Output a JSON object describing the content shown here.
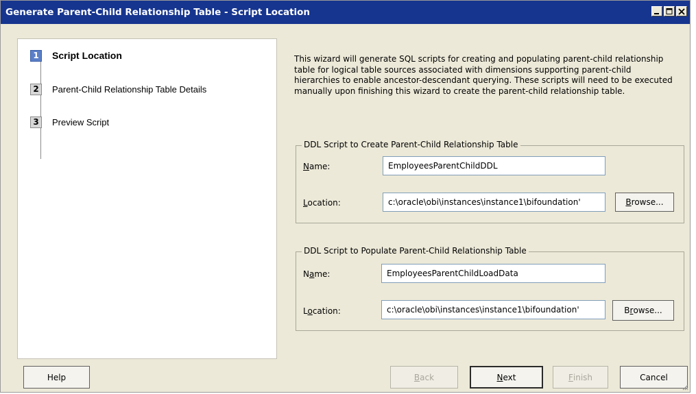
{
  "window": {
    "title": "Generate Parent-Child Relationship Table - Script Location",
    "controls": [
      "minimize-icon",
      "maximize-icon",
      "close-icon"
    ]
  },
  "steps": [
    {
      "number": "1",
      "label": "Script Location",
      "active": true
    },
    {
      "number": "2",
      "label": "Parent-Child Relationship Table Details",
      "active": false
    },
    {
      "number": "3",
      "label": "Preview Script",
      "active": false
    }
  ],
  "intro": "This wizard will generate SQL scripts for creating and populating parent-child relationship table for logical table sources associated with dimensions supporting parent-child hierarchies to enable ancestor-descendant querying. These scripts will need to be executed manually upon finishing this wizard to create the parent-child relationship table.",
  "create_group": {
    "legend": "DDL Script to Create Parent-Child Relationship Table",
    "name_label_key": "N",
    "name_label_rest": "ame:",
    "name_value": "EmployeesParentChildDDL",
    "location_label_key": "L",
    "location_label_rest": "ocation:",
    "location_value": "c:\\oracle\\obi\\instances\\instance1\\bifoundation'",
    "browse_key": "B",
    "browse_rest": "rowse..."
  },
  "populate_group": {
    "legend": "DDL Script to Populate Parent-Child Relationship Table",
    "name_label_pre": "N",
    "name_label_key": "a",
    "name_label_rest": "me:",
    "name_value": "EmployeesParentChildLoadData",
    "location_label_pre": "L",
    "location_label_key": "o",
    "location_label_rest": "cation:",
    "location_value": "c:\\oracle\\obi\\instances\\instance1\\bifoundation'",
    "browse_pre": "B",
    "browse_key": "r",
    "browse_rest": "owse..."
  },
  "footer": {
    "help": "Help",
    "back_key": "B",
    "back_rest": "ack",
    "next_key": "N",
    "next_rest": "ext",
    "finish_key": "F",
    "finish_rest": "inish",
    "cancel": "Cancel"
  },
  "colors": {
    "titlebar": "#16358f",
    "active_step": "#5b7fc8",
    "dialog_bg": "#ece9d8"
  }
}
